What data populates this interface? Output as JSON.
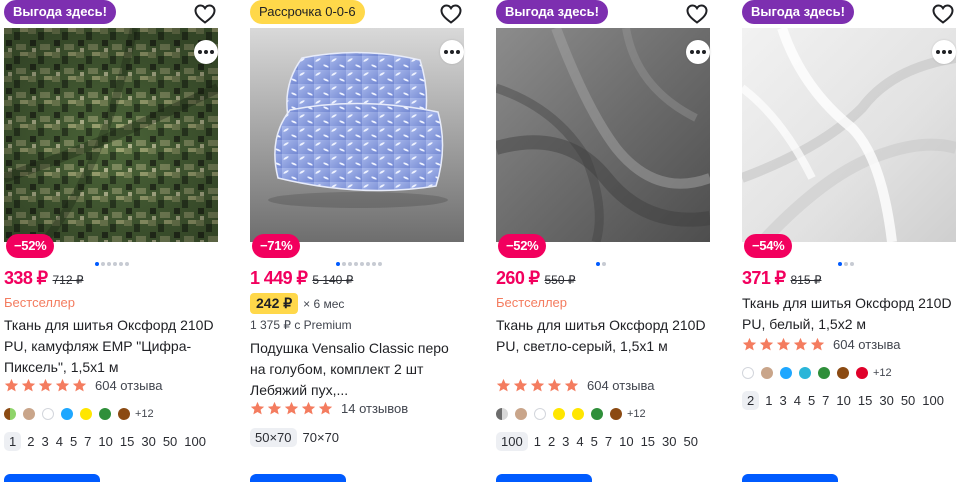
{
  "products": [
    {
      "promo": "Выгода здесь!",
      "discount": "−52%",
      "price": "338 ₽",
      "old_price": "712 ₽",
      "label": "Бестселлер",
      "title": "Ткань для шитья Оксфорд 210D PU, камуфляж EMP \"Цифра-Пиксель\", 1,5х1 м",
      "reviews": "604 отзыва",
      "more_colors": "+12",
      "sizes": [
        "1",
        "2",
        "3",
        "4",
        "5",
        "7",
        "10",
        "15",
        "30",
        "50",
        "100"
      ],
      "swatch_colors": [
        "#9e9e9e",
        "#c9a58a",
        "#ffffff",
        "#1ea7ff",
        "#ffe600",
        "#2f8f3a",
        "#8b4a12"
      ]
    },
    {
      "promo": "Рассрочка 0-0-6",
      "discount": "−71%",
      "price": "1 449 ₽",
      "old_price": "5 140 ₽",
      "installment_price": "242 ₽",
      "installment_term": "× 6 мес",
      "premium_price": "1 375 ₽ с Premium",
      "title": "Подушка Vensalio Classic перо на голубом, комплект 2 шт Лебяжий пух,...",
      "reviews": "14 отзывов",
      "sizes": [
        "50×70",
        "70×70"
      ]
    },
    {
      "promo": "Выгода здесь!",
      "discount": "−52%",
      "price": "260 ₽",
      "old_price": "550 ₽",
      "label": "Бестселлер",
      "title": "Ткань для шитья Оксфорд 210D PU, светло-серый, 1,5х1 м",
      "reviews": "604 отзыва",
      "more_colors": "+12",
      "sizes": [
        "100",
        "1",
        "2",
        "3",
        "4",
        "5",
        "7",
        "10",
        "15",
        "30",
        "50"
      ],
      "swatch_colors": [
        "#9e9e9e",
        "#c9a58a",
        "#ffffff",
        "#1ea7ff",
        "#ffe600",
        "#2f8f3a",
        "#8b4a12"
      ]
    },
    {
      "promo": "Выгода здесь!",
      "discount": "−54%",
      "price": "371 ₽",
      "old_price": "815 ₽",
      "title": "Ткань для шитья Оксфорд 210D PU, белый, 1,5х2 м",
      "reviews": "604 отзыва",
      "more_colors": "+12",
      "sizes": [
        "2",
        "1",
        "3",
        "4",
        "5",
        "7",
        "10",
        "15",
        "30",
        "50",
        "100"
      ],
      "swatch_colors": [
        "#ffffff",
        "#c9a58a",
        "#1ea7ff",
        "#2bb5d8",
        "#2f8f3a",
        "#8b4a12",
        "#e0002a"
      ]
    }
  ],
  "icons": {
    "favorite": "heart-icon",
    "more": "more-icon",
    "rating": "star-icon"
  },
  "colors": {
    "price": "#f2005e",
    "promo_purple": "#7d2fb0",
    "promo_yellow": "#ffd84a",
    "bestseller": "#f47c5f",
    "star": "#f47c5f",
    "button": "#005bff"
  }
}
